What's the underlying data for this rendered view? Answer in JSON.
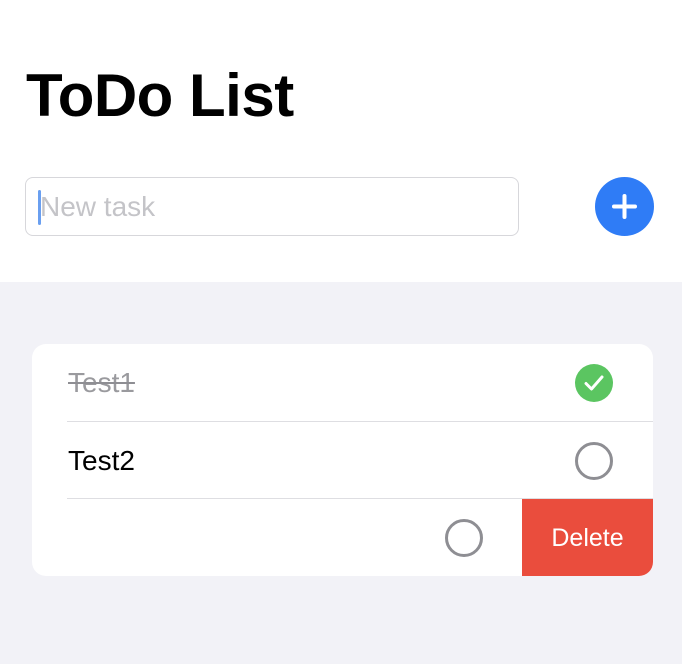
{
  "header": {
    "title": "ToDo List"
  },
  "new_task": {
    "value": "",
    "placeholder": "New task",
    "add_icon": "plus-icon"
  },
  "tasks": [
    {
      "label": "Test1",
      "completed": true,
      "status_icon": "checkmark-circle-icon"
    },
    {
      "label": "Test2",
      "completed": false,
      "status_icon": "empty-circle-icon"
    },
    {
      "label": "",
      "completed": false,
      "status_icon": "empty-circle-icon",
      "swiped": true,
      "action_label": "Delete"
    }
  ],
  "colors": {
    "accent_blue": "#2f7cf6",
    "complete_green": "#5bc561",
    "delete_red": "#ea4d3d",
    "list_background": "#f2f2f7"
  }
}
